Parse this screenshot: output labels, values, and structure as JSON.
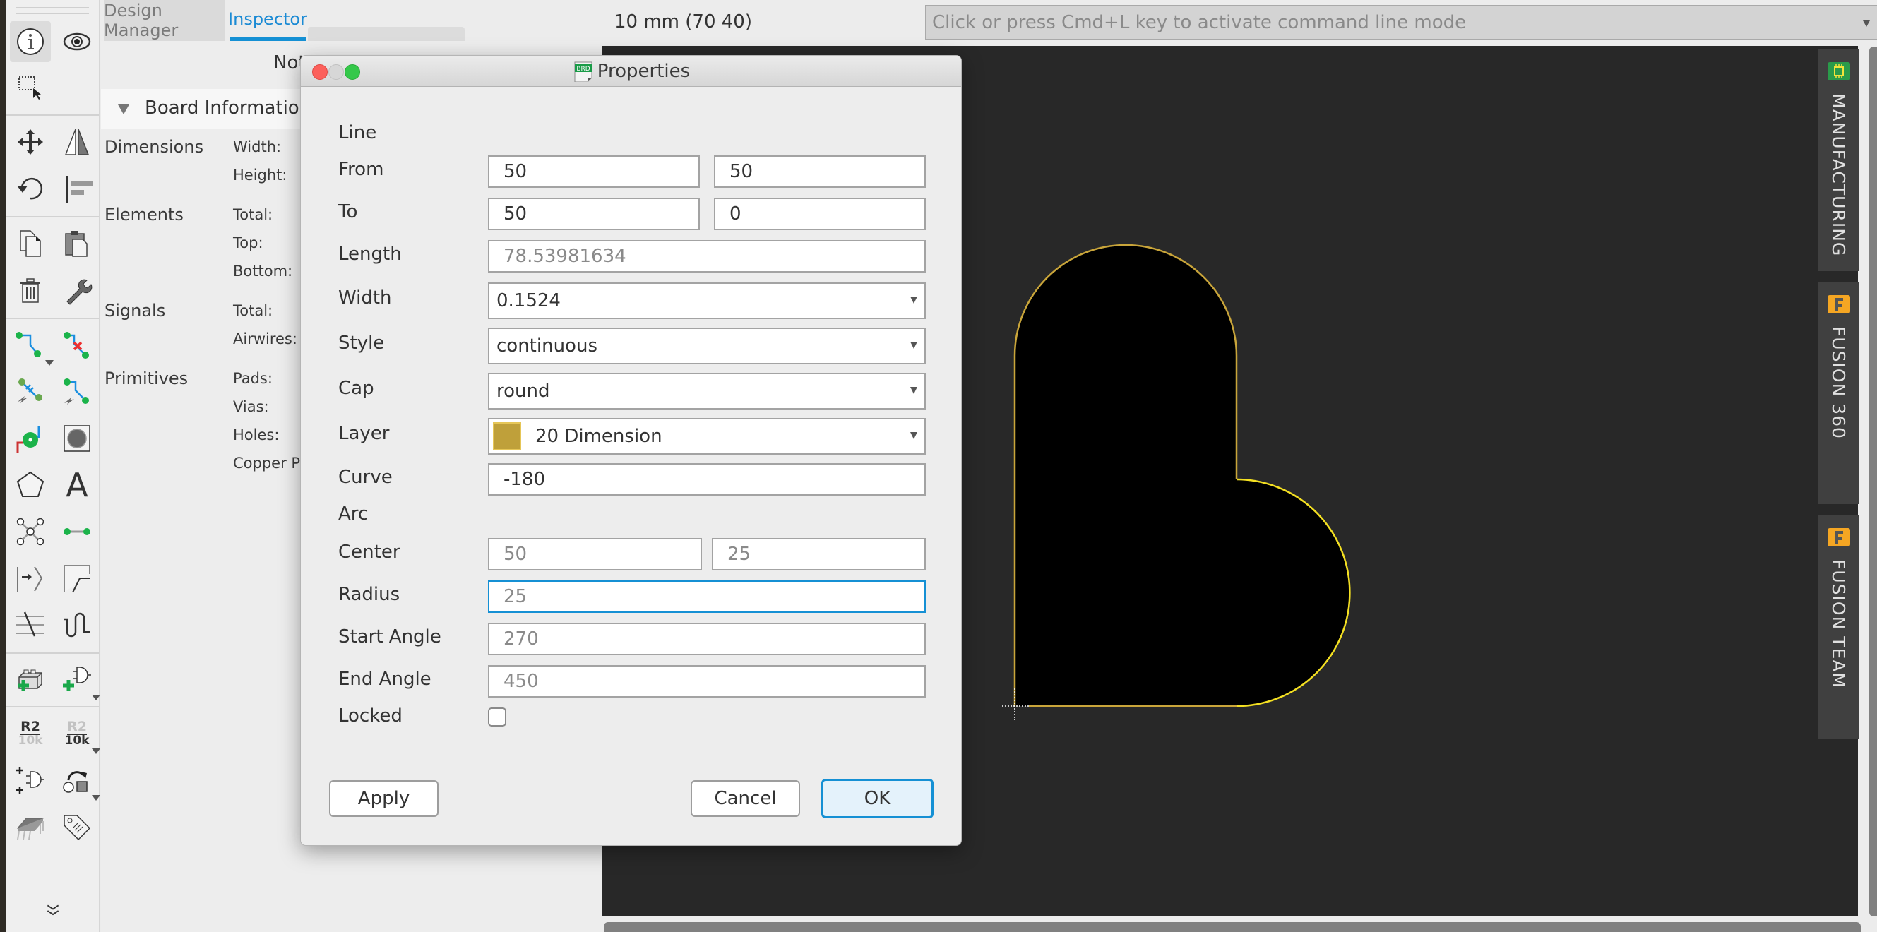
{
  "toolbar": {
    "tools": [
      {
        "name": "info-icon",
        "active": true
      },
      {
        "name": "show-icon"
      },
      {
        "name": "group-select-icon"
      },
      {
        "name": "move-icon"
      },
      {
        "name": "mirror-icon"
      },
      {
        "name": "rotate-icon"
      },
      {
        "name": "align-icon"
      },
      {
        "name": "copy-icon"
      },
      {
        "name": "paste-icon"
      },
      {
        "name": "delete-icon"
      },
      {
        "name": "wrench-icon"
      },
      {
        "name": "route-icon"
      },
      {
        "name": "ripup-icon"
      },
      {
        "name": "autorouter-icon"
      },
      {
        "name": "route-lightning-icon"
      },
      {
        "name": "via-icon"
      },
      {
        "name": "hole-icon"
      },
      {
        "name": "polygon-icon"
      },
      {
        "name": "text-icon"
      },
      {
        "name": "signal-icon"
      },
      {
        "name": "wire-icon"
      },
      {
        "name": "meander-icon"
      },
      {
        "name": "miter-icon"
      },
      {
        "name": "slice-icon"
      },
      {
        "name": "length-tune-icon"
      },
      {
        "name": "add-package-icon"
      },
      {
        "name": "add-gate-icon"
      },
      {
        "name": "name-icon"
      },
      {
        "name": "value-icon"
      },
      {
        "name": "invoke-icon"
      },
      {
        "name": "replace-icon"
      },
      {
        "name": "package-icon"
      },
      {
        "name": "attribute-tag-icon"
      },
      {
        "name": "more-tools-icon"
      }
    ],
    "name_label": {
      "top": "R2",
      "bottom": "10k"
    },
    "value_label": {
      "top": "R2",
      "bottom": "10k"
    },
    "text_glyph": "A"
  },
  "inspector": {
    "tabs": [
      {
        "label": "Design Manager",
        "active": false
      },
      {
        "label": "Inspector",
        "active": true
      }
    ],
    "note_label": "Not",
    "board_info_title": "Board Information",
    "categories": [
      {
        "label": "Dimensions",
        "fields": [
          "Width:",
          "Height:"
        ]
      },
      {
        "label": "Elements",
        "fields": [
          "Total:",
          "Top:",
          "Bottom:"
        ]
      },
      {
        "label": "Signals",
        "fields": [
          "Total:",
          "Airwires:"
        ]
      },
      {
        "label": "Primitives",
        "fields": [
          "Pads:",
          "Vias:",
          "Holes:",
          "Copper P"
        ]
      }
    ]
  },
  "topbar": {
    "coordinate_readout": "10 mm (70 40)",
    "command_line_placeholder": "Click or press Cmd+L key to activate command line mode"
  },
  "right_panel": {
    "tabs": [
      {
        "label": "MANUFACTURING",
        "icon": "manufacturing-icon",
        "icon_color": "#2a9b4a"
      },
      {
        "label": "FUSION 360",
        "icon": "fusion360-icon",
        "icon_color": "#f5a623"
      },
      {
        "label": "FUSION TEAM",
        "icon": "fusion-team-icon",
        "icon_color": "#f5a623"
      }
    ]
  },
  "canvas": {
    "shape": "heart outline on Dimension layer",
    "outline_color": "#c9a53a",
    "highlight_color": "#f4e022"
  },
  "dialog": {
    "title": "Properties",
    "title_icon": "BRD",
    "section_line": "Line",
    "from": {
      "label": "From",
      "x": "50",
      "y": "50"
    },
    "to": {
      "label": "To",
      "x": "50",
      "y": "0"
    },
    "length": {
      "label": "Length",
      "value": "78.53981634"
    },
    "width": {
      "label": "Width",
      "value": "0.1524"
    },
    "style": {
      "label": "Style",
      "value": "continuous"
    },
    "cap": {
      "label": "Cap",
      "value": "round"
    },
    "layer": {
      "label": "Layer",
      "value": "20 Dimension",
      "color": "#bfa03a"
    },
    "curve": {
      "label": "Curve",
      "value": "-180"
    },
    "section_arc": "Arc",
    "center": {
      "label": "Center",
      "x": "50",
      "y": "25"
    },
    "radius": {
      "label": "Radius",
      "value": "25"
    },
    "start_angle": {
      "label": "Start Angle",
      "value": "270"
    },
    "end_angle": {
      "label": "End Angle",
      "value": "450"
    },
    "locked": {
      "label": "Locked",
      "checked": false
    },
    "buttons": {
      "apply": "Apply",
      "cancel": "Cancel",
      "ok": "OK"
    }
  }
}
